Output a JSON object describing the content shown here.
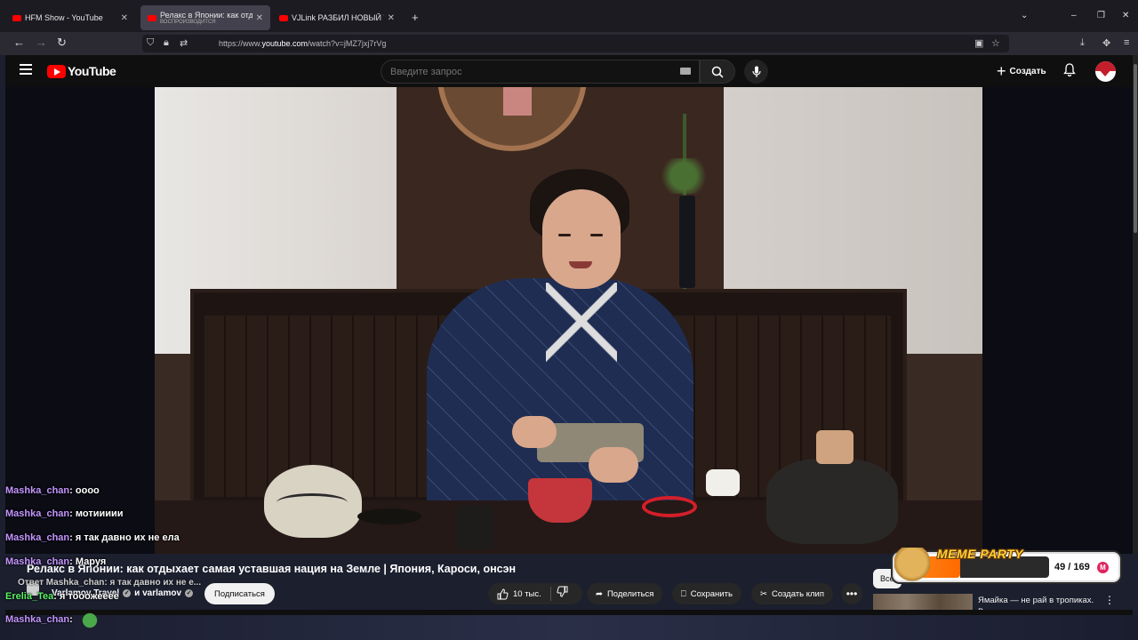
{
  "browser": {
    "tabs": [
      {
        "title": "HFM Show - YouTube",
        "active": false
      },
      {
        "title": "Релакс в Японии: как отдыхает",
        "subtitle": "ВОСПРОИЗВОДИТСЯ",
        "active": true
      },
      {
        "title": "VJLink РАЗБИЛ НОВЫЙ ТЕЛЕВ",
        "active": false
      }
    ],
    "new_tab": "+",
    "url_prefix": "https://www.",
    "url_host": "youtube.com",
    "url_path": "/watch?v=jMZ7jxj7rVg"
  },
  "youtube": {
    "logo_text": "YouTube",
    "search_placeholder": "Введите запрос",
    "create_label": "Создать",
    "plus": "+"
  },
  "video": {
    "title": "Релакс в Японии: как отдыхает самая уставшая нация на Земле | Япония, Кароси, онсэн",
    "channel": "Varlamov Travel",
    "channel_conj": "и varlamov",
    "subscribe_label": "Подписаться",
    "likes": "10 тыс.",
    "share_label": "Поделиться",
    "save_label": "Сохранить",
    "clip_label": "Создать клип",
    "more": "•••"
  },
  "sidebar": {
    "chip_all": "Все",
    "recommendation_title": "Ямайка — не рай в тропиках. Выжить на самом «веселом..."
  },
  "meme_party": {
    "title": "MEME PARTY",
    "count": "49 / 169",
    "badge": "M"
  },
  "chat": [
    {
      "nick": "Mashka_chan",
      "msg": "оооо"
    },
    {
      "nick": "Mashka_chan",
      "msg": "мотиииии"
    },
    {
      "nick": "Mashka_chan",
      "msg": "я так давно их не ела"
    },
    {
      "nick": "Mashka_chan",
      "msg": "Маруя"
    },
    {
      "nick": "Erelia_Tea",
      "msg": "я тооожееее"
    },
    {
      "nick": "Mashka_chan",
      "msg": ""
    }
  ],
  "chat_reply": "Ответ Mashka_chan: я так давно их не е...",
  "colors": {
    "youtube_red": "#ff0000",
    "nick_purple": "#c495ff",
    "nick_green": "#5cf068",
    "meme_orange": "#ff8a1a"
  }
}
